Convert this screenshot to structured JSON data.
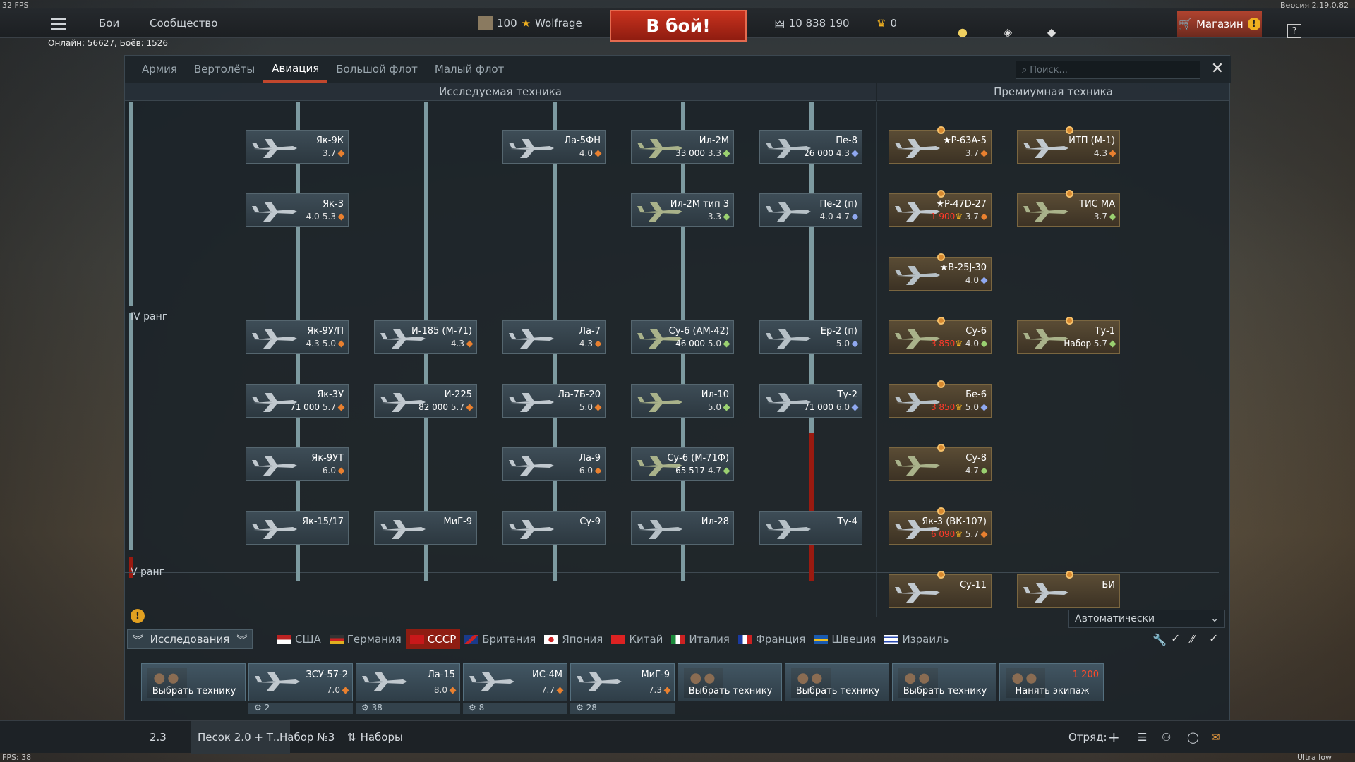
{
  "fps_top": "32 FPS",
  "version": "Версия 2.19.0.82",
  "online": "Онлайн: 56627, Боёв: 1526",
  "fps_bottom": "FPS: 38",
  "quality": "Ultra low quality",
  "top": {
    "battles": "Бои",
    "community": "Сообщество",
    "level": "100",
    "nick": "Wolfrage",
    "to_battle": "В бой!",
    "silver": "10 838 190",
    "gold": "0",
    "shop": "Магазин"
  },
  "tabs": [
    "Армия",
    "Вертолёты",
    "Авиация",
    "Большой флот",
    "Малый флот"
  ],
  "search_placeholder": "Поиск...",
  "headers": {
    "researched": "Исследуемая техника",
    "premium": "Премиумная техника"
  },
  "ranks": {
    "r4": "IV ранг",
    "r5": "V ранг"
  },
  "cards": [
    {
      "name": "Як-9К",
      "br": "3.7",
      "cost": "",
      "type": "fighter"
    },
    {
      "name": "Як-3",
      "br": "4.0-5.3",
      "cost": "",
      "type": "fighter"
    },
    {
      "name": "Як-9У/П",
      "br": "4.3-5.0",
      "cost": "",
      "type": "fighter"
    },
    {
      "name": "Як-3У",
      "br": "5.7",
      "cost": "71 000",
      "type": "fighter"
    },
    {
      "name": "Як-9УТ",
      "br": "6.0",
      "cost": "",
      "type": "fighter"
    },
    {
      "name": "Як-15/17",
      "br": "",
      "cost": "",
      "type": "fighter"
    },
    {
      "name": "И-185 (М-71)",
      "br": "4.3",
      "cost": "",
      "type": "fighter"
    },
    {
      "name": "И-225",
      "br": "5.7",
      "cost": "82 000",
      "type": "fighter"
    },
    {
      "name": "МиГ-9",
      "br": "",
      "cost": "",
      "type": "fighter"
    },
    {
      "name": "Ла-5ФН",
      "br": "4.0",
      "cost": "",
      "type": "fighter"
    },
    {
      "name": "Ла-7",
      "br": "4.3",
      "cost": "",
      "type": "fighter"
    },
    {
      "name": "Ла-7Б-20",
      "br": "5.0",
      "cost": "",
      "type": "fighter"
    },
    {
      "name": "Ла-9",
      "br": "6.0",
      "cost": "",
      "type": "fighter"
    },
    {
      "name": "Су-9",
      "br": "",
      "cost": "",
      "type": "fighter"
    },
    {
      "name": "Ил-2М",
      "br": "3.3",
      "cost": "33 000",
      "type": "attacker"
    },
    {
      "name": "Ил-2М тип 3",
      "br": "3.3",
      "cost": "",
      "type": "attacker"
    },
    {
      "name": "Су-6 (АМ-42)",
      "br": "5.0",
      "cost": "46 000",
      "type": "attacker"
    },
    {
      "name": "Ил-10",
      "br": "5.0",
      "cost": "",
      "type": "attacker"
    },
    {
      "name": "Су-6 (М-71Ф)",
      "br": "4.7",
      "cost": "65 517",
      "type": "attacker"
    },
    {
      "name": "Ил-28",
      "br": "",
      "cost": "",
      "type": "bomber"
    },
    {
      "name": "Пе-8",
      "br": "4.3",
      "cost": "26 000",
      "type": "bomber"
    },
    {
      "name": "Пе-2 (п)",
      "br": "4.0-4.7",
      "cost": "",
      "type": "bomber"
    },
    {
      "name": "Ер-2 (п)",
      "br": "5.0",
      "cost": "",
      "type": "bomber"
    },
    {
      "name": "Ту-2",
      "br": "6.0",
      "cost": "71 000",
      "type": "bomber"
    },
    {
      "name": "Ту-4",
      "br": "",
      "cost": "",
      "type": "bomber"
    }
  ],
  "premium_cards": [
    {
      "name": "★P-63A-5",
      "br": "3.7",
      "cost": "",
      "type": "fighter"
    },
    {
      "name": "★P-47D-27",
      "br": "3.7",
      "cost": "1 900",
      "type": "fighter"
    },
    {
      "name": "★B-25J-30",
      "br": "4.0",
      "cost": "",
      "type": "bomber"
    },
    {
      "name": "Су-6",
      "br": "4.0",
      "cost": "3 850",
      "type": "attacker"
    },
    {
      "name": "Бе-6",
      "br": "5.0",
      "cost": "3 850",
      "type": "bomber"
    },
    {
      "name": "Су-8",
      "br": "4.7",
      "cost": "",
      "type": "attacker"
    },
    {
      "name": "Як-3 (ВК-107)",
      "br": "5.7",
      "cost": "6 090",
      "type": "fighter"
    },
    {
      "name": "Су-11",
      "br": "",
      "cost": "",
      "type": "fighter"
    },
    {
      "name": "ИТП (М-1)",
      "br": "4.3",
      "cost": "",
      "type": "fighter"
    },
    {
      "name": "ТИС МА",
      "br": "3.7",
      "cost": "",
      "type": "attacker"
    },
    {
      "name": "Ту-1",
      "br": "5.7",
      "cost": "Набор",
      "type": "attacker"
    },
    {
      "name": "БИ",
      "br": "",
      "cost": "",
      "type": "fighter"
    }
  ],
  "research_label": "Исследования",
  "nations": [
    "США",
    "Германия",
    "СССР",
    "Британия",
    "Япония",
    "Китай",
    "Италия",
    "Франция",
    "Швеция",
    "Израиль"
  ],
  "auto": "Автоматически",
  "slots": [
    {
      "name": "",
      "br": "",
      "pick": "Выбрать технику",
      "count": ""
    },
    {
      "name": "ЗСУ-57-2",
      "br": "7.0",
      "pick": "",
      "count": "2"
    },
    {
      "name": "Ла-15",
      "br": "8.0",
      "pick": "",
      "count": "38"
    },
    {
      "name": "ИС-4М",
      "br": "7.7",
      "pick": "",
      "count": "8"
    },
    {
      "name": "МиГ-9",
      "br": "7.3",
      "pick": "",
      "count": "28"
    },
    {
      "name": "",
      "br": "",
      "pick": "Выбрать технику",
      "count": ""
    },
    {
      "name": "",
      "br": "",
      "pick": "Выбрать технику",
      "count": ""
    },
    {
      "name": "",
      "br": "",
      "pick": "Выбрать технику",
      "count": ""
    },
    {
      "name": "1 200",
      "br": "",
      "pick": "Нанять экипаж",
      "count": ""
    }
  ],
  "bottom": {
    "br": "2.3",
    "mode": "Песок 2.0 + Т...",
    "preset": "Набор №3",
    "presets": "Наборы",
    "squad": "Отряд:"
  },
  "colors": {
    "accent": "#c2472d",
    "premium": "#5a4c35",
    "research": "#3e4d57",
    "line": "#7d9aa0",
    "red_line": "#9a1a10"
  }
}
